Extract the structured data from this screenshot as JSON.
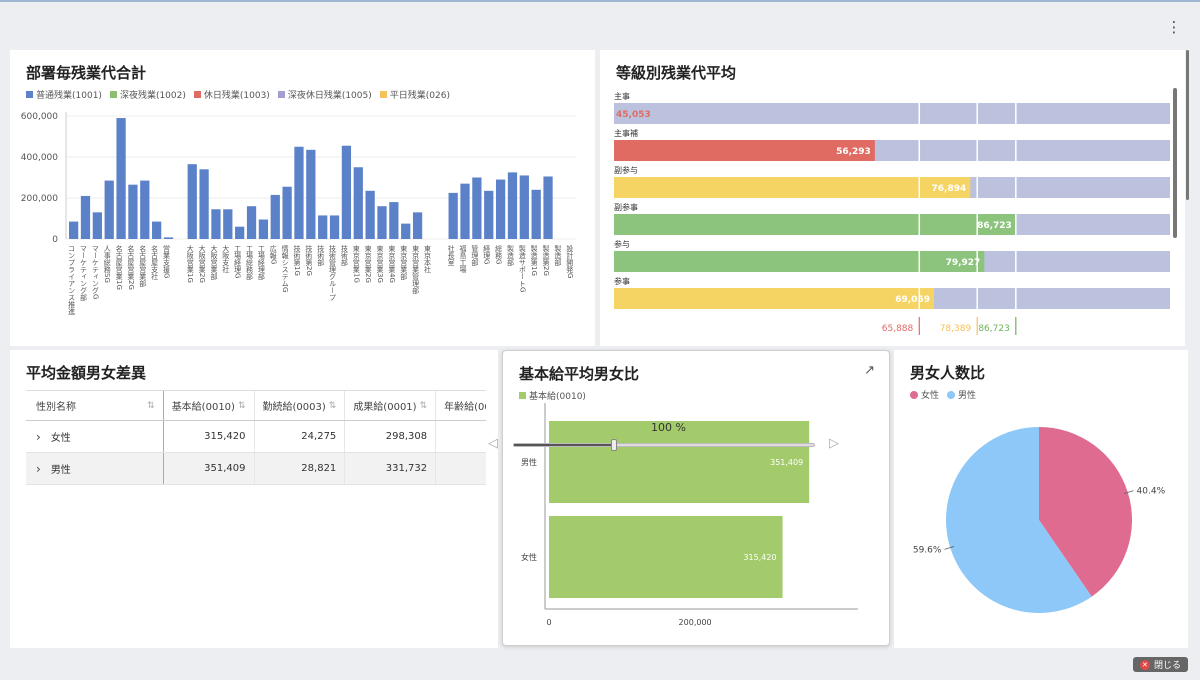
{
  "menu_icon": "kebab-menu-icon",
  "close_label": "閉じる",
  "panels": {
    "dept": {
      "title": "部署毎残業代合計",
      "legend": [
        {
          "label": "普通残業(1001)",
          "color": "#5b82c8"
        },
        {
          "label": "深夜残業(1002)",
          "color": "#8cc06e"
        },
        {
          "label": "休日残業(1003)",
          "color": "#e06b62"
        },
        {
          "label": "深夜休日残業(1005)",
          "color": "#a39fd0"
        },
        {
          "label": "平日残業(026)",
          "color": "#f6c05b"
        }
      ]
    },
    "grade": {
      "title": "等級別残業代平均"
    },
    "table": {
      "title": "平均金額男女差異",
      "columns": [
        "性別名称",
        "基本給(0010)",
        "勤続給(0003)",
        "成果給(0001)",
        "年齢給(00"
      ],
      "rows": [
        {
          "label": "女性",
          "values": [
            "315,420",
            "24,275",
            "298,308"
          ]
        },
        {
          "label": "男性",
          "values": [
            "351,409",
            "28,821",
            "331,732"
          ]
        }
      ]
    },
    "basic": {
      "title": "基本給平均男女比",
      "legend": "基本給(0010)",
      "zoom": "100 %"
    },
    "gender": {
      "title": "男女人数比",
      "legend": [
        "女性",
        "男性"
      ]
    }
  },
  "chart_data": [
    {
      "type": "bar",
      "title": "部署毎残業代合計",
      "ylim": [
        0,
        600000
      ],
      "yticks": [
        "0",
        "200,000",
        "400,000",
        "600,000"
      ],
      "grid": true,
      "categories": [
        "コンプライアンス推進",
        "マーケティング部",
        "マーケティングG",
        "人事総務SG",
        "名古屋営業1G",
        "名古屋営業2G",
        "名古屋営業部",
        "名古屋支社",
        "営業支援G",
        "",
        "大阪営業1G",
        "大阪営業2G",
        "大阪営業部",
        "大阪支社",
        "工場経理G",
        "工場総務部",
        "工場経理部",
        "広報G",
        "情報システムG",
        "技術第1G",
        "技術第2G",
        "技術部",
        "技術管理グループ",
        "技術部",
        "東京営業1G",
        "東京営業2G",
        "東京営業3G",
        "東京営業4G",
        "東京営業部",
        "東京営業管理部",
        "東京本社",
        "",
        "社長室",
        "福島工場",
        "管理部",
        "経理G",
        "総務G",
        "製造部",
        "製造サポートG",
        "製造第1G",
        "製造第2G",
        "製造部",
        "設計開発G"
      ],
      "values": [
        85000,
        210000,
        130000,
        285000,
        590000,
        265000,
        285000,
        85000,
        8000,
        0,
        365000,
        340000,
        145000,
        145000,
        60000,
        160000,
        95000,
        215000,
        255000,
        450000,
        435000,
        115000,
        115000,
        455000,
        350000,
        235000,
        160000,
        180000,
        75000,
        130000,
        0,
        0,
        225000,
        270000,
        300000,
        235000,
        290000,
        325000,
        310000,
        240000,
        305000
      ],
      "series_color": "#5b82c8"
    },
    {
      "type": "bar",
      "title": "等級別残業代平均",
      "orientation": "horizontal",
      "categories": [
        "主事",
        "主事補",
        "副参与",
        "副参事",
        "参与",
        "参事"
      ],
      "values": [
        45053,
        56293,
        76894,
        86723,
        79927,
        69059
      ],
      "colors": [
        "#bcc2de",
        "#e06b62",
        "#f6d464",
        "#8cc47e",
        "#8cc47e",
        "#f6d464"
      ],
      "reference_lines": [
        {
          "label": "65,888",
          "value": 65888,
          "color": "#e06b62"
        },
        {
          "label": "78,389",
          "value": 78389,
          "color": "#f6c05b"
        },
        {
          "label": "86,723",
          "value": 86723,
          "color": "#6cb35a"
        }
      ],
      "xmax": 120000
    },
    {
      "type": "bar",
      "title": "基本給平均男女比",
      "orientation": "horizontal",
      "categories": [
        "男性",
        "女性"
      ],
      "values": [
        351409,
        315420
      ],
      "value_labels": [
        "351,409",
        "315,420"
      ],
      "xticks": [
        "0",
        "200,000"
      ],
      "xmax": 420000,
      "series_color": "#a3cb6c"
    },
    {
      "type": "pie",
      "title": "男女人数比",
      "labels": [
        "女性",
        "男性"
      ],
      "values": [
        40.4,
        59.6
      ],
      "value_labels": [
        "40.4%",
        "59.6%"
      ],
      "colors": [
        "#df6b90",
        "#8ec8f8"
      ]
    }
  ]
}
